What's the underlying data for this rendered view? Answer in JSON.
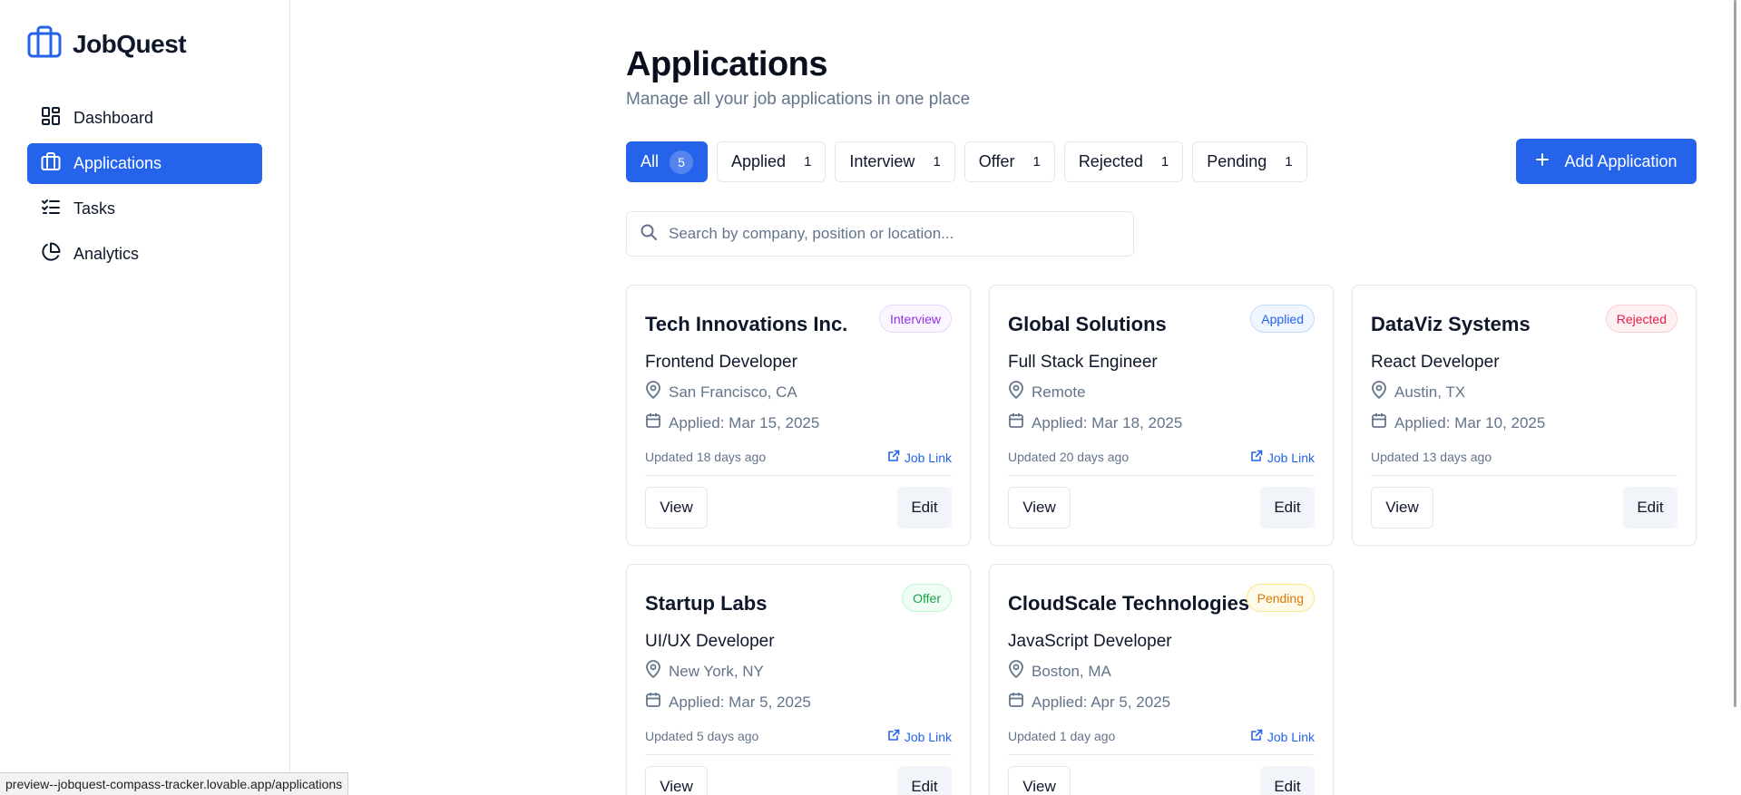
{
  "app": {
    "name": "JobQuest"
  },
  "sidebar": {
    "items": [
      {
        "label": "Dashboard",
        "icon": "dashboard-icon"
      },
      {
        "label": "Applications",
        "icon": "briefcase-icon",
        "active": true
      },
      {
        "label": "Tasks",
        "icon": "checklist-icon"
      },
      {
        "label": "Analytics",
        "icon": "pie-chart-icon"
      }
    ]
  },
  "page": {
    "title": "Applications",
    "subtitle": "Manage all your job applications in one place"
  },
  "filters": [
    {
      "label": "All",
      "count": "5",
      "active": true
    },
    {
      "label": "Applied",
      "count": "1"
    },
    {
      "label": "Interview",
      "count": "1"
    },
    {
      "label": "Offer",
      "count": "1"
    },
    {
      "label": "Rejected",
      "count": "1"
    },
    {
      "label": "Pending",
      "count": "1"
    }
  ],
  "actions": {
    "add_label": "Add Application"
  },
  "search": {
    "placeholder": "Search by company, position or location...",
    "value": ""
  },
  "cards": [
    {
      "company": "Tech Innovations Inc.",
      "status": "Interview",
      "position": "Frontend Developer",
      "location": "San Francisco, CA",
      "applied": "Applied: Mar 15, 2025",
      "updated": "Updated 18 days ago",
      "job_link": "Job Link",
      "view": "View",
      "edit": "Edit"
    },
    {
      "company": "Global Solutions",
      "status": "Applied",
      "position": "Full Stack Engineer",
      "location": "Remote",
      "applied": "Applied: Mar 18, 2025",
      "updated": "Updated 20 days ago",
      "job_link": "Job Link",
      "view": "View",
      "edit": "Edit"
    },
    {
      "company": "DataViz Systems",
      "status": "Rejected",
      "position": "React Developer",
      "location": "Austin, TX",
      "applied": "Applied: Mar 10, 2025",
      "updated": "Updated 13 days ago",
      "job_link": "",
      "view": "View",
      "edit": "Edit"
    },
    {
      "company": "Startup Labs",
      "status": "Offer",
      "position": "UI/UX Developer",
      "location": "New York, NY",
      "applied": "Applied: Mar 5, 2025",
      "updated": "Updated 5 days ago",
      "job_link": "Job Link",
      "view": "View",
      "edit": "Edit"
    },
    {
      "company": "CloudScale Technologies",
      "status": "Pending",
      "position": "JavaScript Developer",
      "location": "Boston, MA",
      "applied": "Applied: Apr 5, 2025",
      "updated": "Updated 1 day ago",
      "job_link": "Job Link",
      "view": "View",
      "edit": "Edit"
    }
  ],
  "status_colors": {
    "Interview": {
      "text": "#9333ea",
      "bg": "#faf5ff",
      "border": "#e9d5ff"
    },
    "Applied": {
      "text": "#2563eb",
      "bg": "#eff6ff",
      "border": "#bfdbfe"
    },
    "Rejected": {
      "text": "#e11d48",
      "bg": "#fff1f2",
      "border": "#fecdd3"
    },
    "Offer": {
      "text": "#16a34a",
      "bg": "#f0fdf4",
      "border": "#bbf7d0"
    },
    "Pending": {
      "text": "#d97706",
      "bg": "#fffbeb",
      "border": "#fde68a"
    }
  },
  "colors": {
    "accent": "#2563eb"
  },
  "statusbar": {
    "url": "preview--jobquest-compass-tracker.lovable.app/applications"
  }
}
